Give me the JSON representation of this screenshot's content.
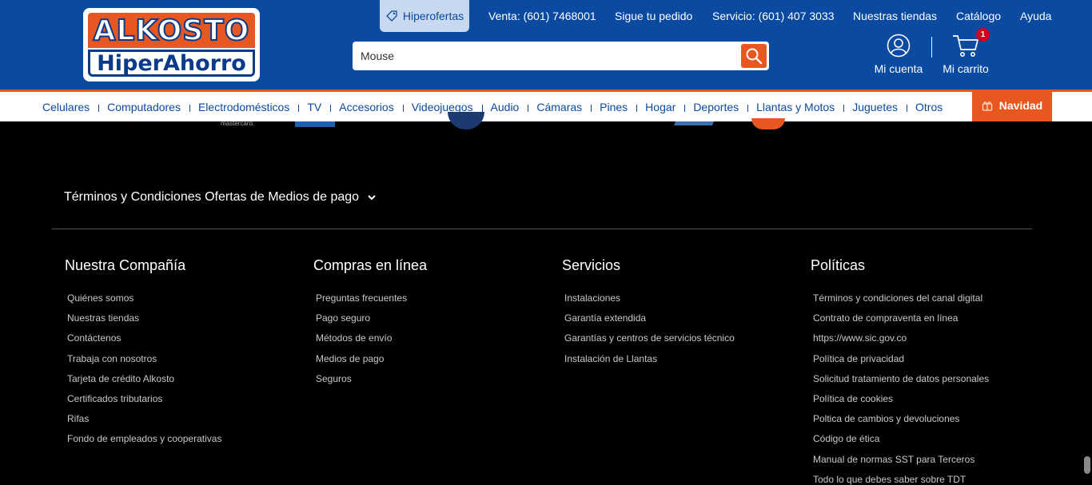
{
  "header": {
    "logo_top": "ALKOSTO",
    "logo_bottom": "HiperAhorro",
    "hiperofertas": "Hiperofertas",
    "links": [
      "Venta: (601) 7468001",
      "Sigue tu pedido",
      "Servicio: (601) 407 3033",
      "Nuestras tiendas",
      "Catálogo",
      "Ayuda"
    ],
    "search_value": "Mouse",
    "account_label": "Mi cuenta",
    "cart_label": "Mi carrito",
    "cart_count": "1"
  },
  "nav": {
    "items": [
      "Celulares",
      "Computadores",
      "Electrodomésticos",
      "TV",
      "Accesorios",
      "Videojuegos",
      "Audio",
      "Cámaras",
      "Pines",
      "Hogar",
      "Deportes",
      "Llantas y Motos",
      "Juguetes",
      "Otros"
    ],
    "highlight": "Navidad"
  },
  "footer": {
    "partial_logo_text": "mastercard.",
    "terms_toggle": "Términos y Condiciones Ofertas de Medios de pago",
    "columns": [
      {
        "title": "Nuestra Compañía",
        "links": [
          "Quiénes somos",
          "Nuestras tiendas",
          "Contáctenos",
          "Trabaja con nosotros",
          "Tarjeta de crédito Alkosto",
          "Certificados tributarios",
          "Rifas",
          "Fondo de empleados y cooperativas"
        ]
      },
      {
        "title": "Compras en línea",
        "links": [
          "Preguntas frecuentes",
          "Pago seguro",
          "Métodos de envío",
          "Medios de pago",
          "Seguros"
        ]
      },
      {
        "title": "Servicios",
        "links": [
          "Instalaciones",
          "Garantía extendida",
          "Garantías y centros de servicios técnico",
          "Instalación de Llantas"
        ]
      },
      {
        "title": "Políticas",
        "links": [
          "Términos y condiciones del canal digital",
          "Contrato de compraventa en línea",
          "https://www.sic.gov.co",
          "Política de privacidad",
          "Solicitud tratamiento de datos personales",
          "Política de cookies",
          "Poltica de cambios y devoluciones",
          "Código de ética",
          "Manual de normas SST para Terceros",
          "Todo lo que debes saber sobre TDT"
        ]
      }
    ]
  },
  "colors": {
    "brand_blue": "#0a4aa0",
    "brand_orange": "#e8571f",
    "footer_bg": "#000000"
  }
}
